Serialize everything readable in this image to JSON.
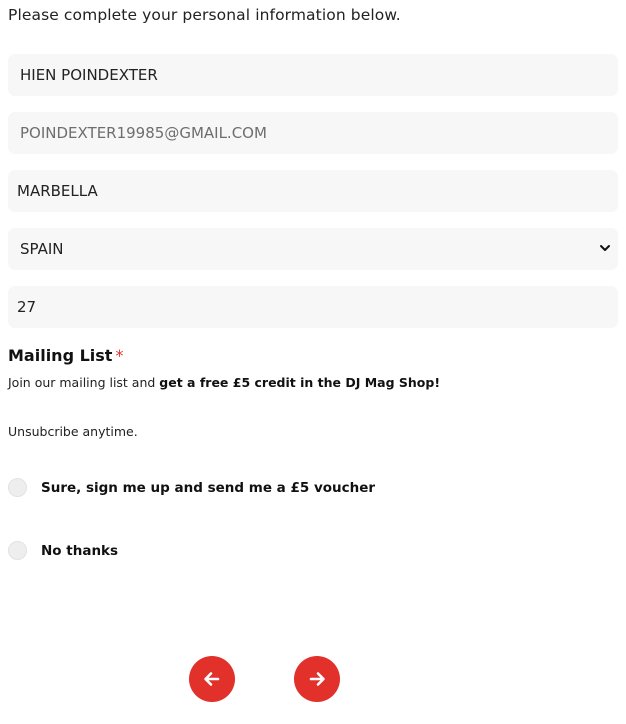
{
  "intro_text": "Please complete your personal information below.",
  "fields": {
    "name": "HIEN POINDEXTER",
    "email": "POINDEXTER19985@GMAIL.COM",
    "city": "MARBELLA",
    "country": "SPAIN",
    "age": "27"
  },
  "mailing": {
    "title": "Mailing List",
    "required_marker": "*",
    "desc_prefix": "Join our mailing list and ",
    "desc_bold": "get a free £5 credit in the DJ Mag Shop!",
    "unsubscribe": "Unsubcribe anytime.",
    "options": [
      {
        "label": "Sure, sign me up and send me a £5 voucher"
      },
      {
        "label": "No thanks"
      }
    ]
  },
  "nav": {
    "prev_icon": "arrow-left-icon",
    "next_icon": "arrow-right-icon"
  },
  "colors": {
    "accent": "#e2302b",
    "field_bg": "#f7f7f7"
  }
}
